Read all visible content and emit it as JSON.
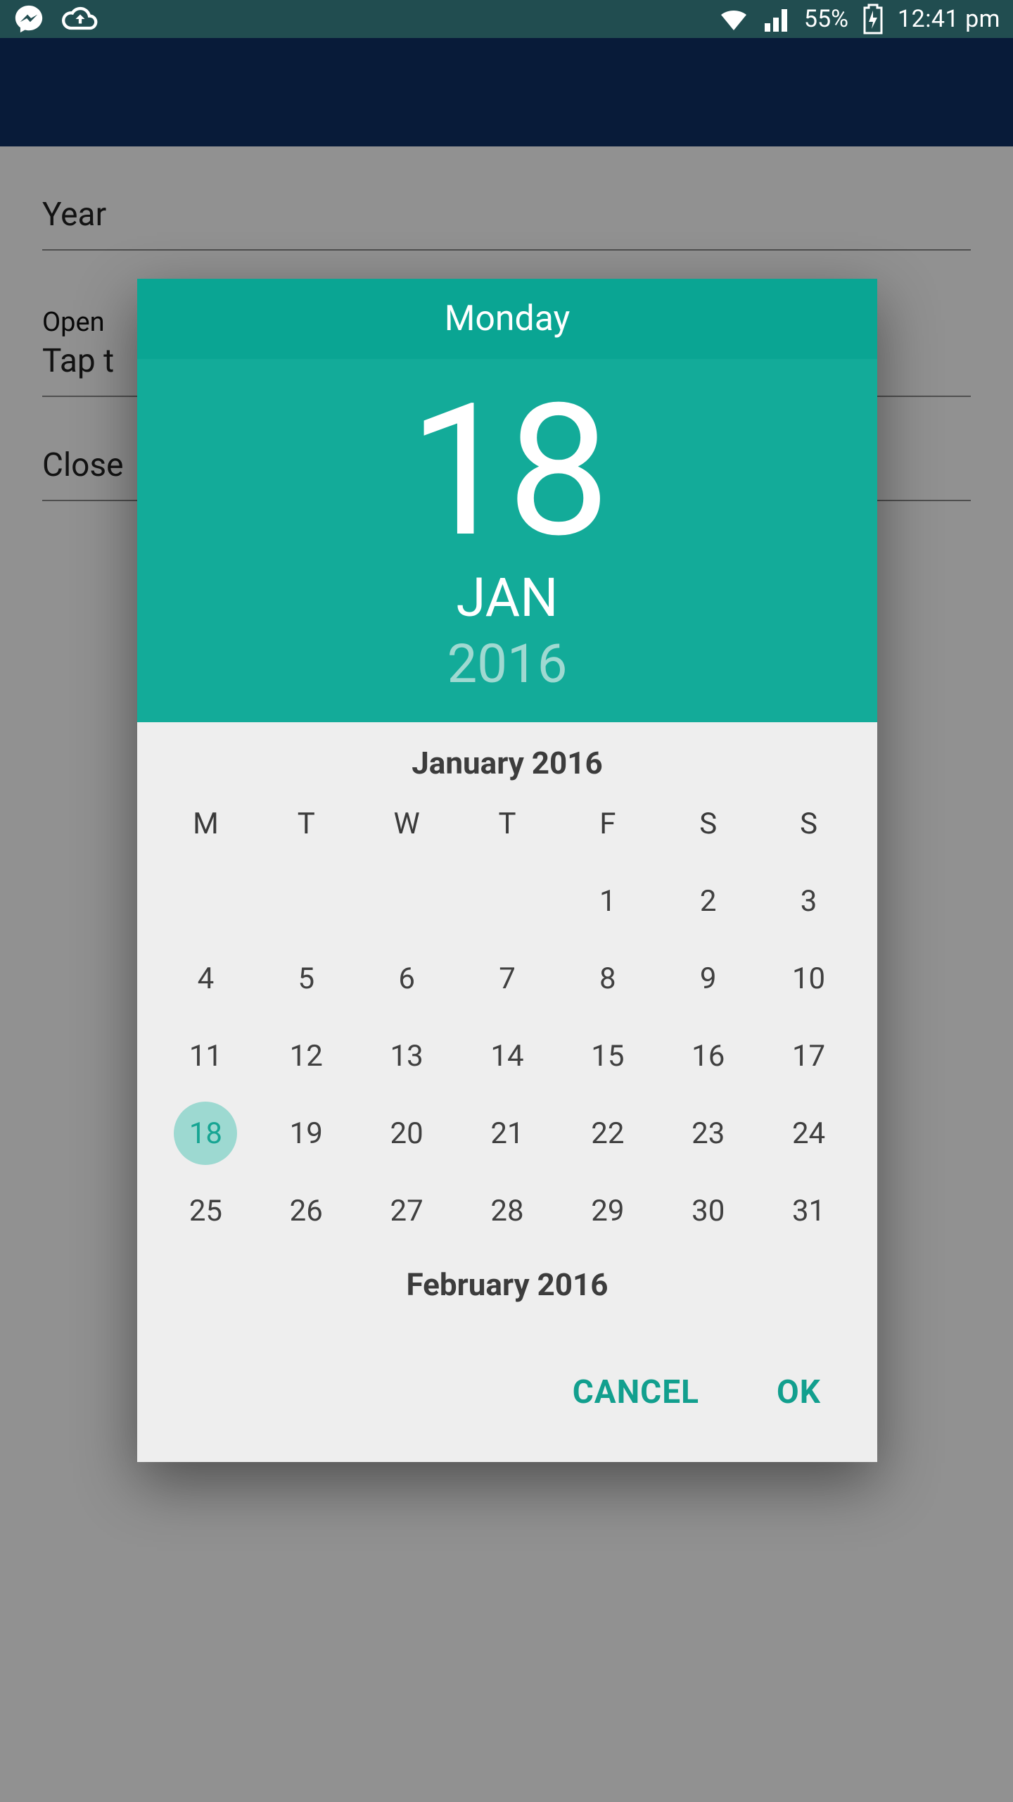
{
  "status": {
    "battery": "55%",
    "time": "12:41 pm"
  },
  "page": {
    "field1_label": "Year",
    "field2_label": "Open",
    "field2_value": "Tap t",
    "field3_label": "Close"
  },
  "datepicker": {
    "weekday": "Monday",
    "day": "18",
    "month_abbr": "JAN",
    "year": "2016",
    "cal_title": "January 2016",
    "next_title": "February 2016",
    "dow": [
      "M",
      "T",
      "W",
      "T",
      "F",
      "S",
      "S"
    ],
    "weeks": [
      [
        "",
        "",
        "",
        "",
        "1",
        "2",
        "3"
      ],
      [
        "4",
        "5",
        "6",
        "7",
        "8",
        "9",
        "10"
      ],
      [
        "11",
        "12",
        "13",
        "14",
        "15",
        "16",
        "17"
      ],
      [
        "18",
        "19",
        "20",
        "21",
        "22",
        "23",
        "24"
      ],
      [
        "25",
        "26",
        "27",
        "28",
        "29",
        "30",
        "31"
      ]
    ],
    "selected_day": "18",
    "actions": {
      "cancel": "CANCEL",
      "ok": "OK"
    }
  }
}
